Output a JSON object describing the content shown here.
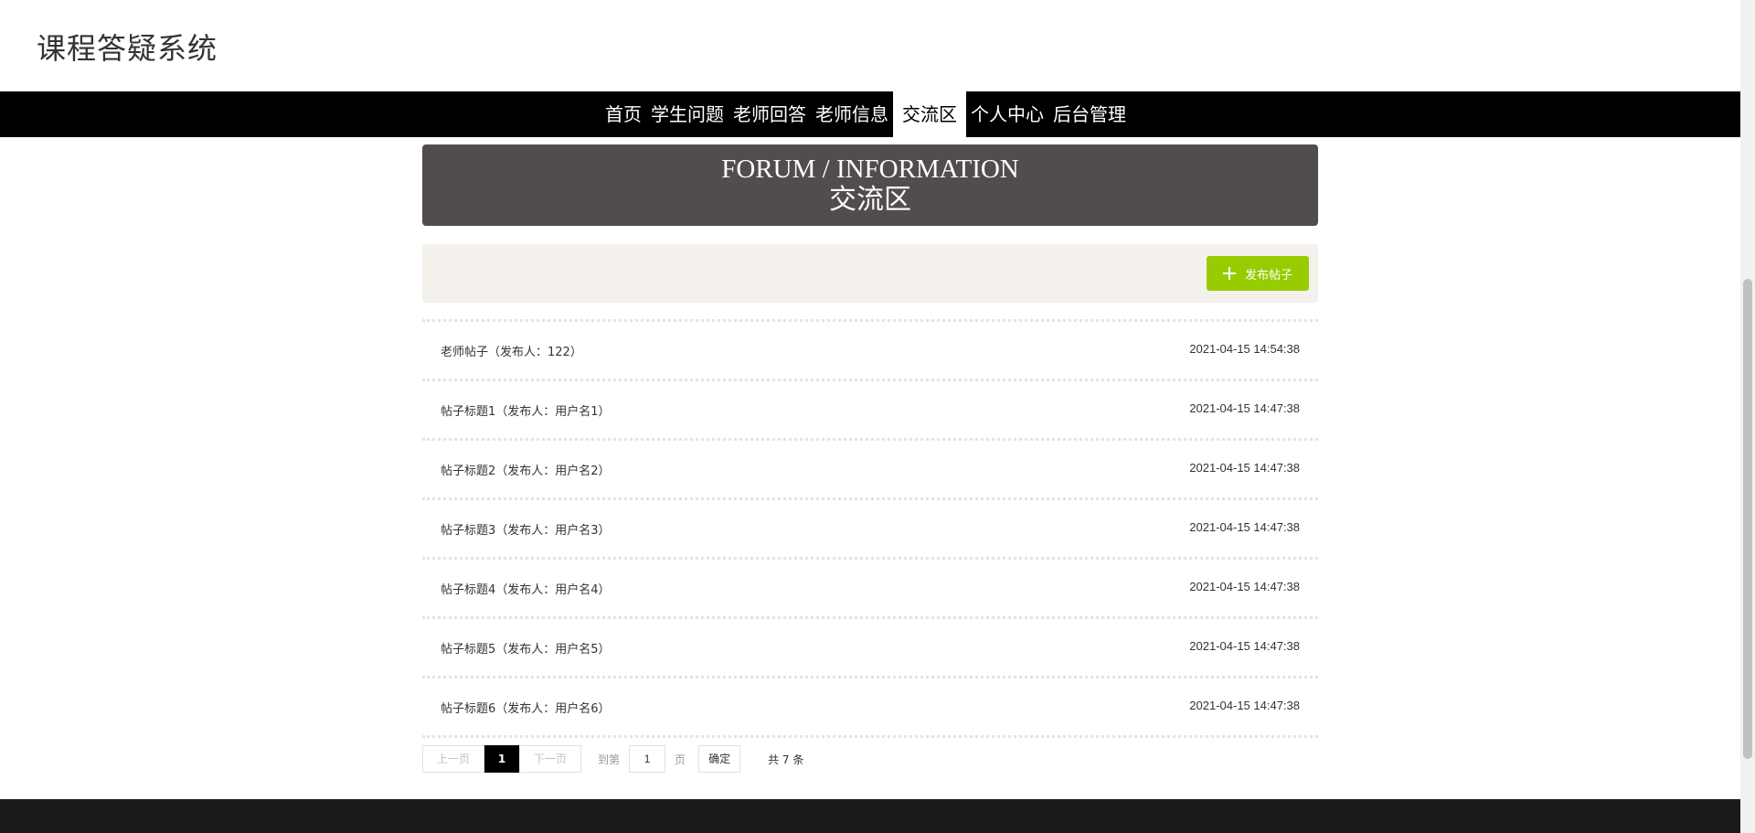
{
  "header": {
    "site_title": "课程答疑系统"
  },
  "nav": {
    "items": [
      {
        "label": "首页"
      },
      {
        "label": "学生问题"
      },
      {
        "label": "老师回答"
      },
      {
        "label": "老师信息"
      },
      {
        "label": "交流区",
        "active": true
      },
      {
        "label": "个人中心"
      },
      {
        "label": "后台管理"
      }
    ]
  },
  "banner": {
    "title_en": "FORUM / INFORMATION",
    "title_cn": "交流区"
  },
  "toolbar": {
    "publish_label": "发布帖子",
    "publish_icon": "plus-icon",
    "accent_color": "#97cc00"
  },
  "posts": [
    {
      "title": "老师帖子（发布人：122）",
      "time": "2021-04-15 14:54:38"
    },
    {
      "title": "帖子标题1（发布人：用户名1）",
      "time": "2021-04-15 14:47:38"
    },
    {
      "title": "帖子标题2（发布人：用户名2）",
      "time": "2021-04-15 14:47:38"
    },
    {
      "title": "帖子标题3（发布人：用户名3）",
      "time": "2021-04-15 14:47:38"
    },
    {
      "title": "帖子标题4（发布人：用户名4）",
      "time": "2021-04-15 14:47:38"
    },
    {
      "title": "帖子标题5（发布人：用户名5）",
      "time": "2021-04-15 14:47:38"
    },
    {
      "title": "帖子标题6（发布人：用户名6）",
      "time": "2021-04-15 14:47:38"
    }
  ],
  "pager": {
    "prev_label": "上一页",
    "current_page": "1",
    "next_label": "下一页",
    "goto_label": "到第",
    "goto_value": "1",
    "page_unit": "页",
    "confirm_label": "确定",
    "total_label": "共 7 条"
  }
}
